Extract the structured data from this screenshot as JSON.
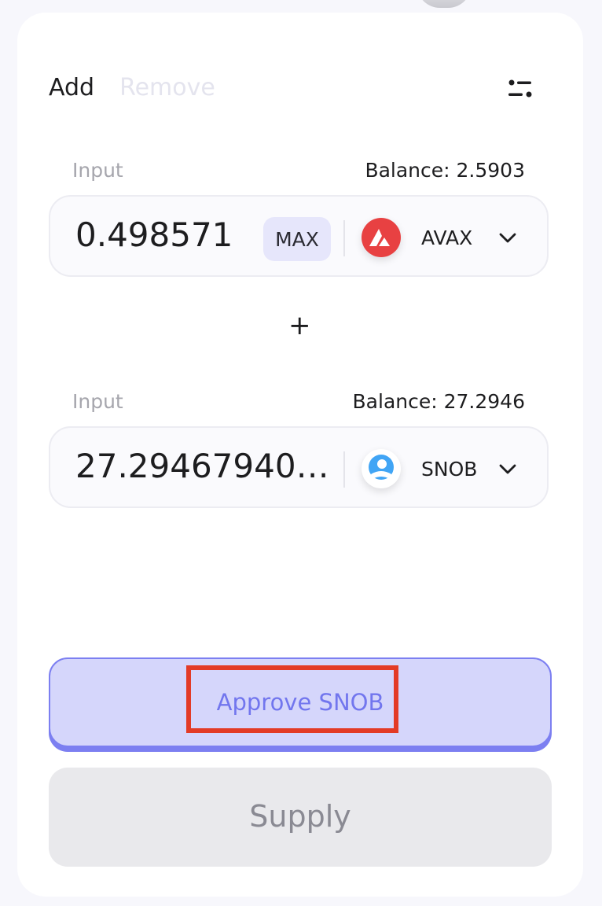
{
  "tabs": {
    "add": "Add",
    "remove": "Remove"
  },
  "input_a": {
    "label": "Input",
    "balance": "Balance: 2.5903",
    "amount": "0.498571",
    "max_label": "MAX",
    "token": "AVAX",
    "token_icon": "avax-logo-icon",
    "token_color": "#e84142"
  },
  "plus": "+",
  "input_b": {
    "label": "Input",
    "balance": "Balance: 27.2946",
    "amount": "27.29467940…",
    "token": "SNOB",
    "token_icon": "snob-logo-icon",
    "token_color": "#41a5f5"
  },
  "buttons": {
    "approve": "Approve SNOB",
    "supply": "Supply"
  },
  "colors": {
    "accent": "#7276ee",
    "approve_bg": "#d5d6fb",
    "highlight": "#e33b26"
  }
}
